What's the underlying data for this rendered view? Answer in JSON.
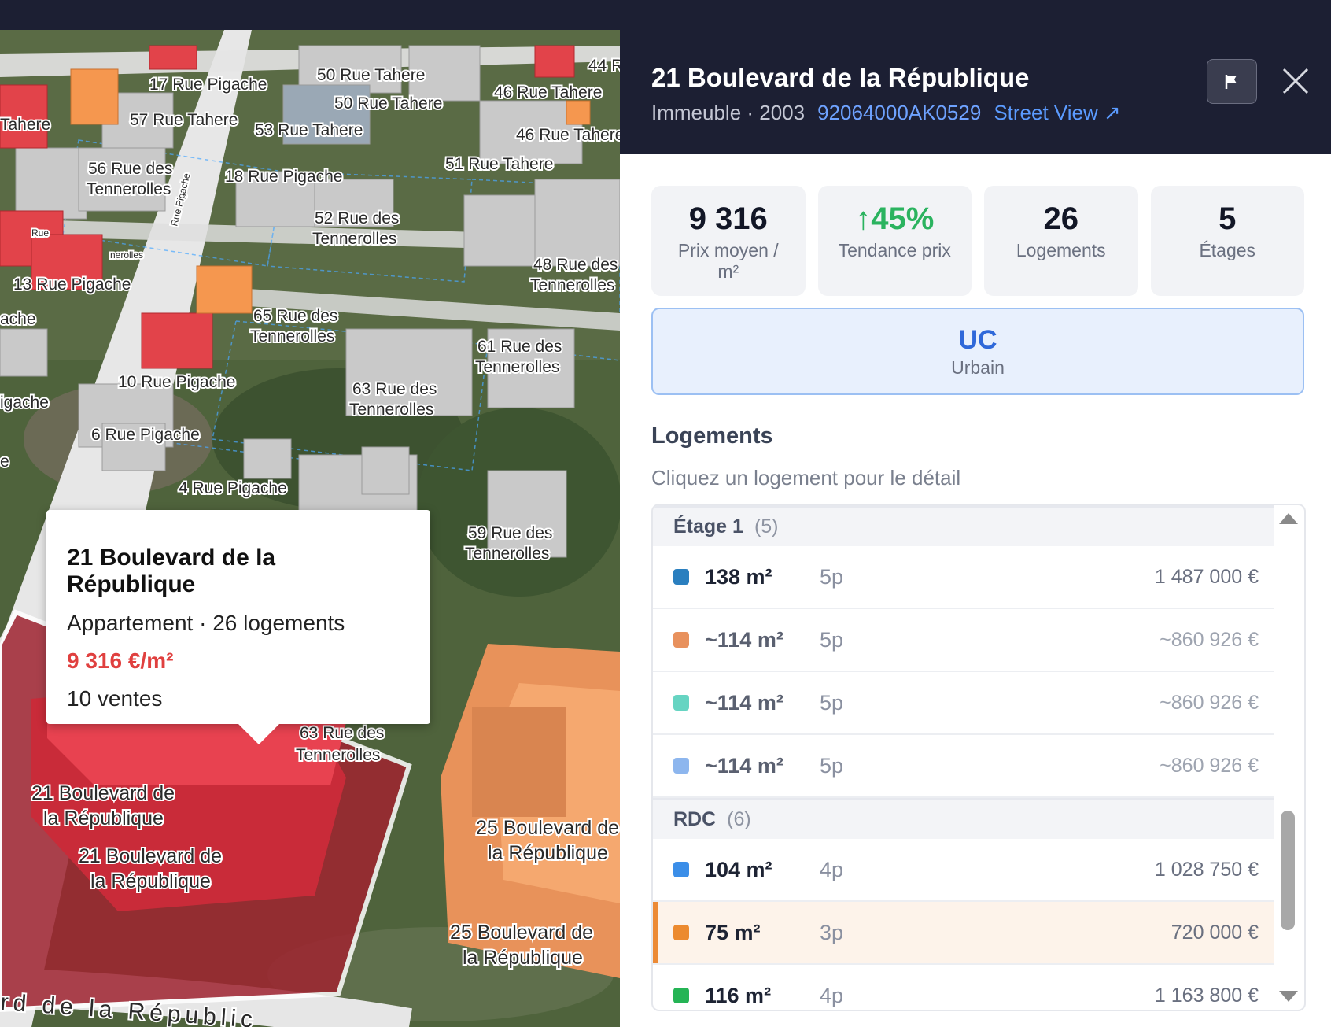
{
  "map": {
    "street_labels": [
      "17 Rue Pigache",
      "50 Rue Tahere",
      "50 Rue Tahere",
      "46 Rue Tahere",
      "44 R",
      "Tahere",
      "57 Rue Tahere",
      "53 Rue Tahere",
      "46 Rue Tahere",
      "56 Rue des",
      "Tennerolles",
      "18 Rue Pigache",
      "51 Rue Tahere",
      "52 Rue des",
      "Tennerolles",
      "48 Rue des",
      "Tennerolles",
      "13 Rue Pigache",
      "65 Rue des",
      "Tennerolles",
      "ache",
      "61 Rue des",
      "Tennerolles",
      "10 Rue Pigache",
      "63 Rue des",
      "Tennerolles",
      "igache",
      "6 Rue Pigache",
      "4 Rue Pigache",
      "59 Rue des",
      "Tennerolles",
      "63 Rue des",
      "Tennerolles",
      "21 Boulevard de",
      "la République",
      "21 Boulevard de",
      "la République",
      "25 Boulevard de",
      "la République",
      "25 Boulevard de",
      "la République",
      "rd de la Républic",
      "Rue Pigache",
      "Rue",
      "nerolles",
      "e"
    ],
    "popup": {
      "title": "21 Boulevard de la République",
      "subtitle": "Appartement · 26 logements",
      "price": "9 316 €/m²",
      "sales": "10 ventes"
    }
  },
  "panel": {
    "title": "21 Boulevard de la République",
    "type_year": "Immeuble · 2003",
    "cadastre": "92064000AK0529",
    "street_view": "Street View ↗",
    "stats": [
      {
        "value": "9 316",
        "label": "Prix moyen / m²"
      },
      {
        "value": "↑45%",
        "label": "Tendance prix"
      },
      {
        "value": "26",
        "label": "Logements"
      },
      {
        "value": "5",
        "label": "Étages"
      }
    ],
    "zone": {
      "code": "UC",
      "label": "Urbain"
    },
    "section_title": "Logements",
    "section_hint": "Cliquez un logement pour le détail",
    "groups": [
      {
        "name": "Étage 1",
        "count": "(5)",
        "rows": [
          {
            "color": "#2a7fbf",
            "area": "138 m²",
            "rooms": "5p",
            "price": "1 487 000 €",
            "approx": false
          },
          {
            "color": "#e8915d",
            "area": "~114 m²",
            "rooms": "5p",
            "price": "~860 926 €",
            "approx": true
          },
          {
            "color": "#66d4c2",
            "area": "~114 m²",
            "rooms": "5p",
            "price": "~860 926 €",
            "approx": true
          },
          {
            "color": "#8db6ee",
            "area": "~114 m²",
            "rooms": "5p",
            "price": "~860 926 €",
            "approx": true
          }
        ]
      },
      {
        "name": "RDC",
        "count": "(6)",
        "rows": [
          {
            "color": "#3b8ee8",
            "area": "104 m²",
            "rooms": "4p",
            "price": "1 028 750 €",
            "approx": false
          },
          {
            "color": "#ec8a2f",
            "area": "75 m²",
            "rooms": "3p",
            "price": "720 000 €",
            "approx": false,
            "selected": true
          },
          {
            "color": "#25b455",
            "area": "116 m²",
            "rooms": "4p",
            "price": "1 163 800 €",
            "approx": false
          }
        ]
      }
    ]
  },
  "colors": {
    "header_bg": "#1c1f33",
    "accent_red": "#e0403f",
    "trend_green": "#2bb35f",
    "zone_blue": "#2f68d9",
    "selected_orange": "#ec8a35"
  },
  "icons": [
    "flag-icon",
    "close-icon",
    "chevron-up-icon",
    "chevron-down-icon"
  ]
}
